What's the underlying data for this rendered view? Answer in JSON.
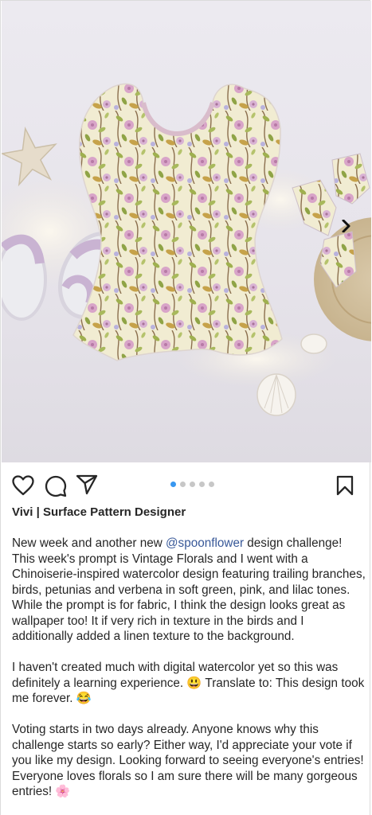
{
  "post": {
    "username": "Vivi | Surface Pattern Designer",
    "image_alt": "Floral baby romper flat-lay with sandals, starfish, seashells and sun hat",
    "carousel": {
      "count": 5,
      "active_index": 0
    }
  },
  "caption": {
    "p1_before": "New week and another new ",
    "mention": "@spoonflower",
    "p1_after": " design challenge! This week's prompt is Vintage Florals and I went with a Chinoiserie-inspired watercolor design featuring trailing branches, birds, petunias and verbena in soft green, pink, and lilac tones. While the prompt is for fabric, I think the design looks great as wallpaper too! It if very rich in texture in the birds and I additionally added a linen texture to the background.",
    "p2": "I haven't created much with digital watercolor yet so this was definitely a learning experience. 😃 Translate to: This design took me forever. 😂",
    "p3": "Voting starts in two days already. Anyone knows why this challenge starts so early? Either way, I'd appreciate your vote if you like my design. Looking forward to seeing everyone's entries! Everyone loves florals so I am sure there will be many gorgeous entries! 🌸"
  },
  "icons": {
    "like": "heart-icon",
    "comment": "comment-icon",
    "share": "send-icon",
    "save": "bookmark-icon",
    "next": "chevron-right-icon"
  },
  "colors": {
    "accent_dot": "#3897f0",
    "mention": "#385898",
    "text": "#262626"
  }
}
